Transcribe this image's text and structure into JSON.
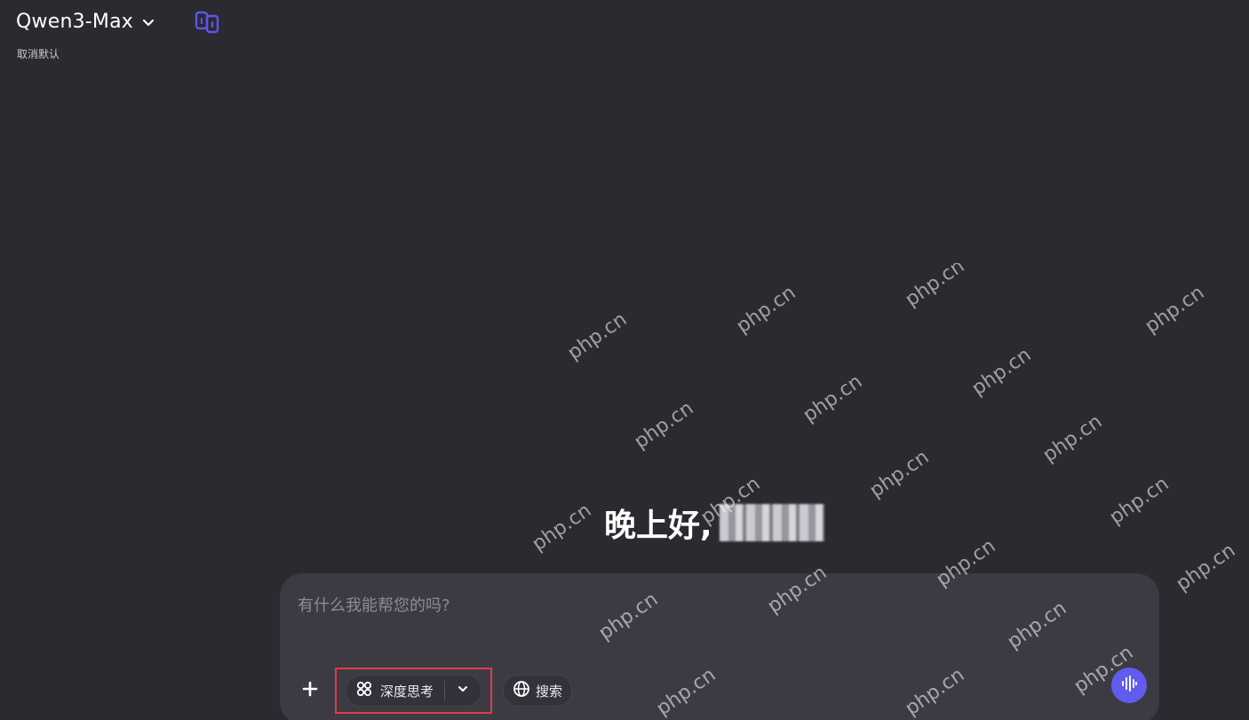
{
  "header": {
    "model_name": "Qwen3-Max",
    "cancel_default": "取消默认",
    "compare_icon_color": "#5b57e8"
  },
  "greeting": {
    "text": "晚上好,"
  },
  "composer": {
    "placeholder": "有什么我能帮您的吗?",
    "deep_think_label": "深度思考",
    "search_label": "搜索",
    "voice_color": "#615ced"
  },
  "watermark": {
    "text": "php.cn"
  }
}
